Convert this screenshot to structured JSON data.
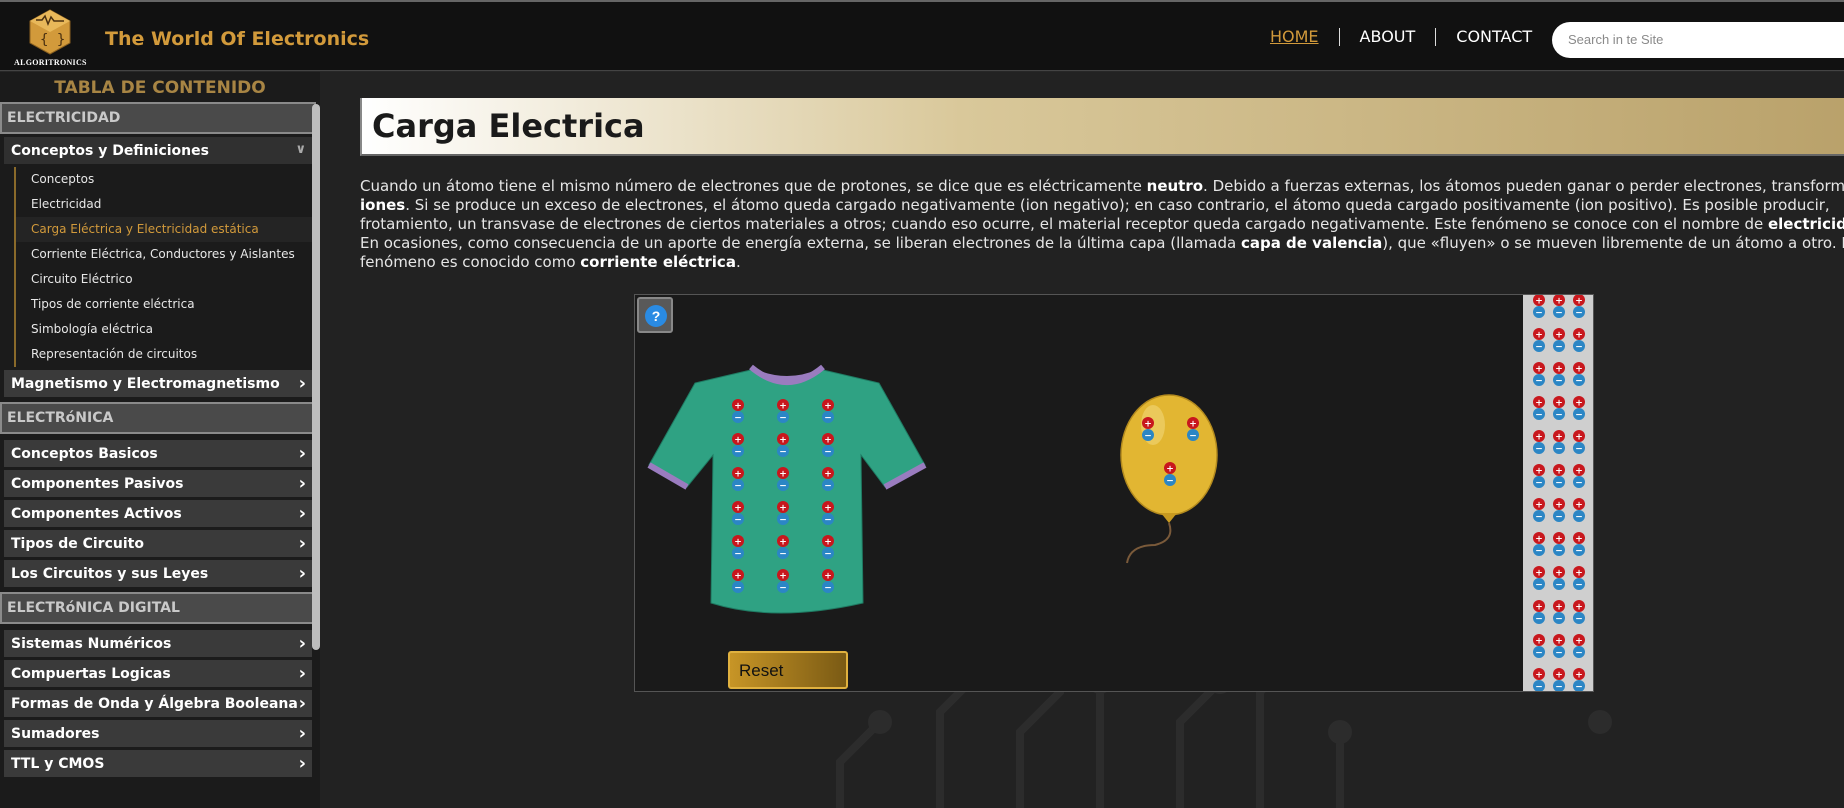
{
  "header": {
    "logo_text": "ALGORITRONICS",
    "site_title": "The World Of Electronics",
    "nav": [
      "HOME",
      "ABOUT",
      "CONTACT"
    ],
    "search_placeholder": "Search in te Site"
  },
  "sidebar": {
    "title": "TABLA DE CONTENIDO",
    "sections": [
      {
        "label": "ELECTRICIDAD",
        "categories": [
          {
            "label": "Conceptos y Definiciones",
            "expanded": true,
            "items": [
              "Conceptos",
              "Electricidad",
              "Carga Eléctrica y Electricidad estática",
              "Corriente Eléctrica, Conductores y Aislantes",
              "Circuito Eléctrico",
              "Tipos de corriente eléctrica",
              "Simbología eléctrica",
              "Representación de circuitos"
            ]
          },
          {
            "label": "Magnetismo y Electromagnetismo"
          }
        ]
      },
      {
        "label": "ELECTRóNICA",
        "categories": [
          {
            "label": "Conceptos Basicos"
          },
          {
            "label": "Componentes Pasivos"
          },
          {
            "label": "Componentes Activos"
          },
          {
            "label": "Tipos de Circuito"
          },
          {
            "label": "Los Circuitos y sus Leyes"
          }
        ]
      },
      {
        "label": "ELECTRóNICA DIGITAL",
        "categories": [
          {
            "label": "Sistemas Numéricos"
          },
          {
            "label": "Compuertas Logicas"
          },
          {
            "label": "Formas de Onda y Álgebra Booleana"
          },
          {
            "label": "Sumadores"
          },
          {
            "label": "TTL y CMOS"
          }
        ]
      }
    ],
    "active_item": "Carga Eléctrica y Electricidad estática"
  },
  "main": {
    "title": "Carga Electrica",
    "paragraph_lines": [
      [
        {
          "t": "Cuando un átomo tiene el mismo número de electrones que de protones, se dice que es eléctricamente "
        },
        {
          "t": "neutro",
          "b": true
        },
        {
          "t": ". Debido a fuerzas externas, los átomos pueden ganar o perder electrones, transformándose"
        }
      ],
      [
        {
          "t": "iones",
          "b": true
        },
        {
          "t": ". Si se produce un exceso de electrones, el átomo queda cargado negativamente (ion negativo); en caso contrario, el átomo queda cargado positivamente (ion positivo). Es posible producir,"
        }
      ],
      [
        {
          "t": "frotamiento, un transvase de electrones de ciertos materiales a otros; cuando eso ocurre, el material receptor queda cargado negativamente. Este fenómeno se conoce con el nombre de "
        },
        {
          "t": "electricidad estáti",
          "b": true
        }
      ],
      [
        {
          "t": "En ocasiones, como consecuencia de un aporte de energía externa, se liberan electrones de la última capa (llamada "
        },
        {
          "t": "capa de valencia",
          "b": true
        },
        {
          "t": "), que «fluyen» o se mueven libremente de un átomo a otro. E"
        }
      ],
      [
        {
          "t": "fenómeno es conocido como "
        },
        {
          "t": "corriente eléctrica",
          "b": true
        },
        {
          "t": "."
        }
      ]
    ]
  },
  "simulation": {
    "help_label": "?",
    "reset_label": "Reset",
    "sweater_charge_pairs": 18,
    "balloon_charge_pairs": 3,
    "wall_charge_pairs": 36,
    "plus_sign": "+",
    "minus_sign": "−",
    "colors": {
      "positive": "#c8171d",
      "negative": "#2b86c5",
      "sweater": "#2fa283",
      "balloon": "#e2b632",
      "accent": "#d29a3b"
    }
  }
}
